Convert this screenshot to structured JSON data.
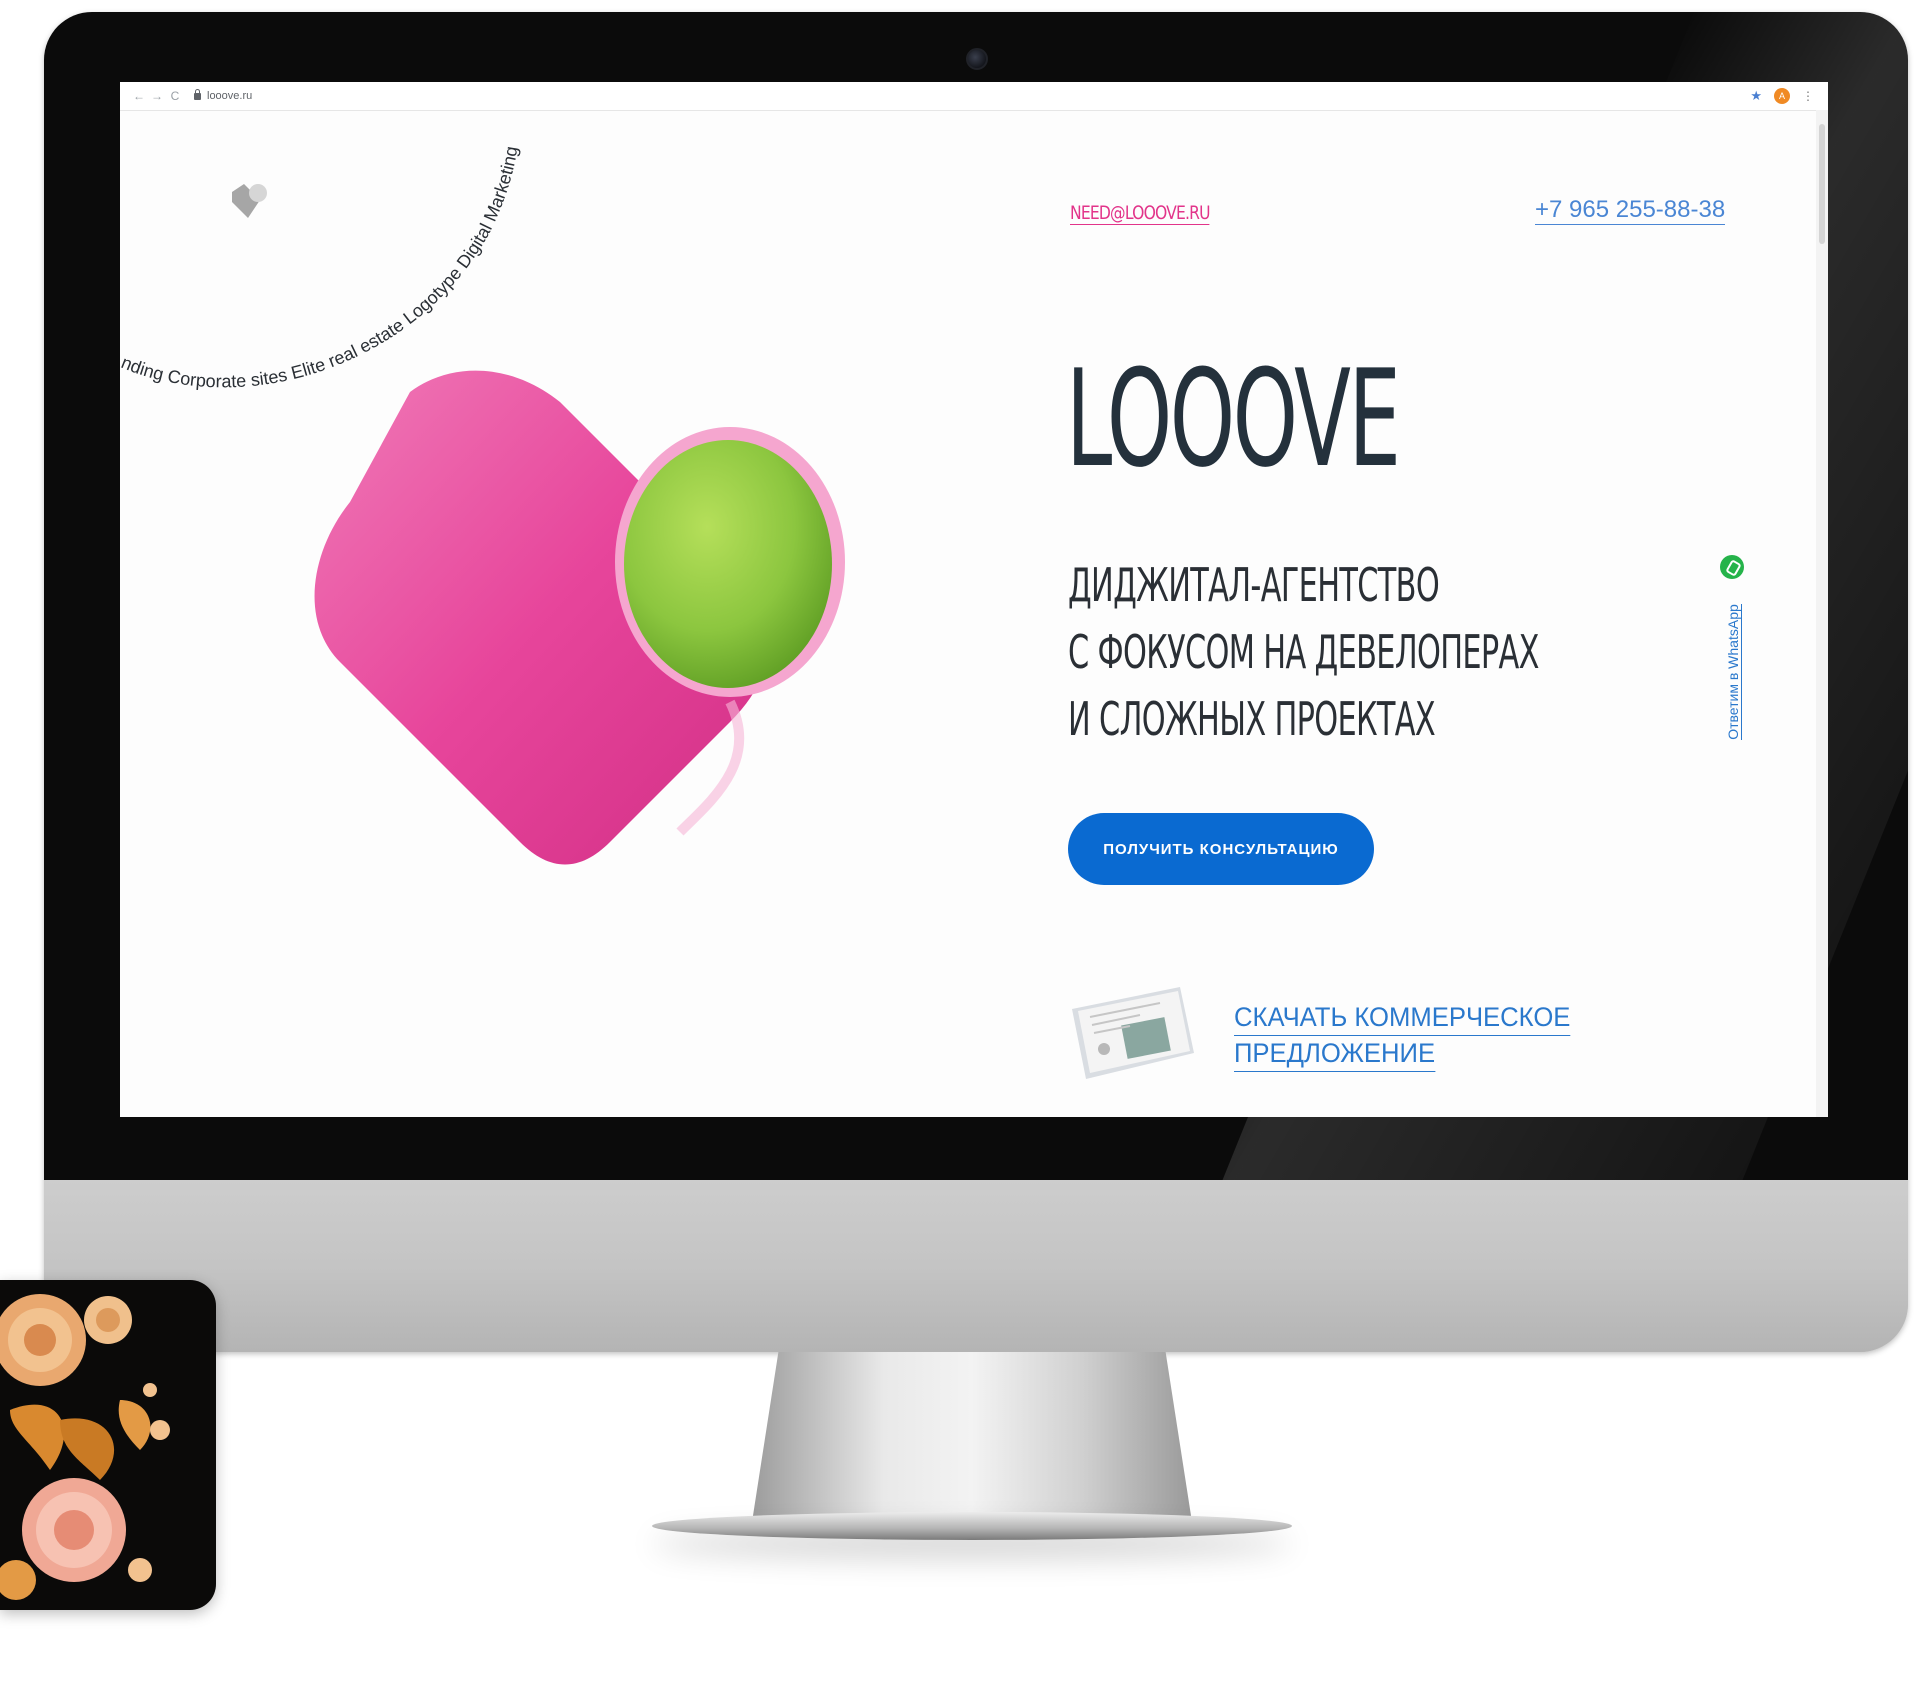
{
  "browser": {
    "url": "looove.ru",
    "back": "←",
    "forward": "→",
    "reload": "C",
    "star": "★",
    "avatar": "A",
    "menu": "⋮"
  },
  "page": {
    "email": "NEED@LOOOVE.RU",
    "phone": "+7 965 255-88-38",
    "brand": "LOOOVE",
    "tagline": [
      "ДИДЖИТАЛ-АГЕНТСТВО",
      "С ФОКУСОМ НА ДЕВЕЛОПЕРАХ",
      "И СЛОЖНЫХ ПРОЕКТАХ"
    ],
    "cta": "получить консультацию",
    "download": [
      "СКАЧАТЬ КОММЕРЧЕСКОЕ",
      "ПРЕДЛОЖЕНИЕ"
    ],
    "whatsapp": "Ответим в WhatsApp",
    "arc_text": "nding Corporate sites  Elite real estate  Logotype  Digital  Marketing"
  },
  "colors": {
    "accent_pink": "#e2348a",
    "accent_blue": "#0a6ad1",
    "link_blue": "#2a78cc",
    "heart_pink": "#e7459b",
    "heart_green": "#8cc63f",
    "title_dark": "#24313c"
  },
  "icons": {
    "logo": "heart-logo-icon",
    "whatsapp": "whatsapp-icon",
    "lock": "lock-icon",
    "bookmark": "star-icon"
  }
}
